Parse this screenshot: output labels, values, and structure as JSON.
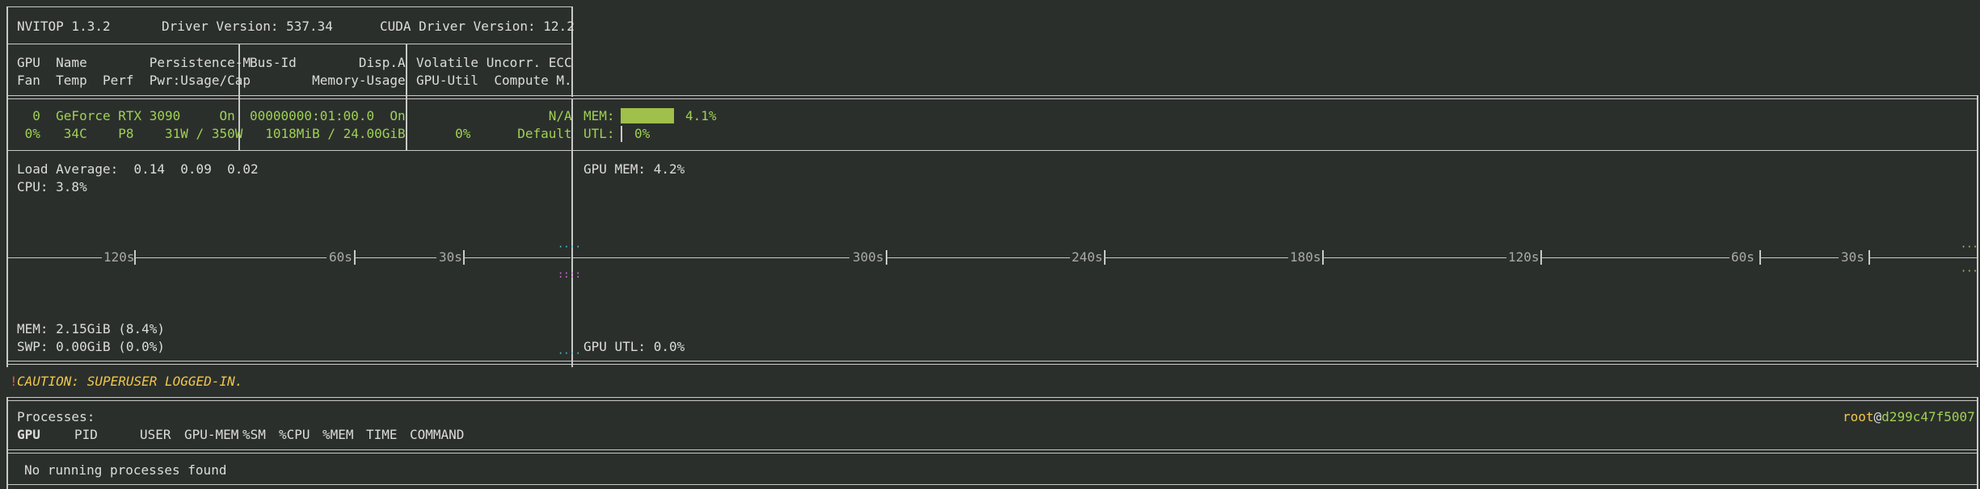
{
  "header": {
    "app": "NVITOP 1.3.2",
    "driver": "Driver Version: 537.34",
    "cuda": "CUDA Driver Version: 12.2"
  },
  "columns": {
    "r1c1": "GPU  Name        Persistence-M",
    "r2c1": "Fan  Temp  Perf  Pwr:Usage/Cap",
    "r1c2": "Bus-Id        Disp.A",
    "r2c2": "        Memory-Usage",
    "r1c3": "Volatile Uncorr. ECC",
    "r2c3": "GPU-Util  Compute M."
  },
  "gpu": {
    "r1c1": "  0  GeForce RTX 3090     On",
    "r2c1": " 0%   34C    P8    31W / 350W",
    "r1c2": "00000000:01:00.0  On",
    "r2c2": "  1018MiB / 24.00GiB",
    "r1c3": "                 N/A",
    "r2c3": "     0%      Default",
    "mem_label": "MEM:",
    "mem_value": "4.1%",
    "mem_fraction": 0.041,
    "utl_label": "UTL:",
    "utl_value": "0%"
  },
  "host": {
    "load": "Load Average:  0.14  0.09  0.02",
    "cpu": "CPU: 3.8%",
    "mem": "MEM: 2.15GiB (8.4%)",
    "swp": "SWP: 0.00GiB (0.0%)",
    "ticks": [
      "120s",
      "60s",
      "30s"
    ]
  },
  "gpu_graph": {
    "mem": "GPU MEM: 4.2%",
    "utl": "GPU UTL: 0.0%",
    "ticks": [
      "300s",
      "240s",
      "180s",
      "120s",
      "60s",
      "30s"
    ]
  },
  "caution": {
    "mark": "!",
    "text": "CAUTION: SUPERUSER LOGGED-IN."
  },
  "processes": {
    "title": "Processes:",
    "user": "root",
    "at": "@",
    "host": "d299c47f5007",
    "headers": [
      "GPU",
      "PID",
      "USER",
      "GPU-MEM",
      "%SM",
      "%CPU",
      "%MEM",
      "TIME",
      "COMMAND"
    ],
    "empty": "No running processes found"
  },
  "colors": {
    "background": "#2b2f2c",
    "green": "#9fd153",
    "caution": "#f0c64a",
    "cyan": "#4fc3d9",
    "magenta": "#d070d0"
  }
}
